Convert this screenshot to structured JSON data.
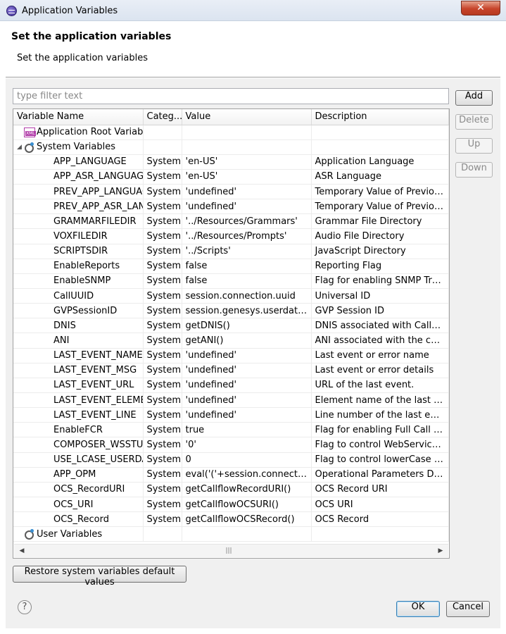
{
  "window": {
    "title": "Application Variables",
    "close_glyph": "✕"
  },
  "header": {
    "title": "Set the application variables",
    "subtitle": "Set the application variables"
  },
  "filter": {
    "placeholder": "type filter text",
    "value": ""
  },
  "table": {
    "columns": [
      "Variable Name",
      "Categ...",
      "Value",
      "Description"
    ],
    "groups": [
      {
        "name": "Application Root Variab",
        "icon": "xml-file-icon",
        "expanded": false
      },
      {
        "name": "System Variables",
        "icon": "variables-icon",
        "expanded": true
      },
      {
        "name": "User Variables",
        "icon": "variables-icon",
        "expanded": false
      }
    ],
    "rows": [
      [
        "APP_LANGUAGE",
        "System",
        "'en-US'",
        "Application Language"
      ],
      [
        "APP_ASR_LANGUAGE",
        "System",
        "'en-US'",
        "ASR Language"
      ],
      [
        "PREV_APP_LANGUAG",
        "System",
        "'undefined'",
        "Temporary Value of Previous ..."
      ],
      [
        "PREV_APP_ASR_LANG",
        "System",
        "'undefined'",
        "Temporary Value of Previous ..."
      ],
      [
        "GRAMMARFILEDIR",
        "System",
        "'../Resources/Grammars'",
        "Grammar File Directory"
      ],
      [
        "VOXFILEDIR",
        "System",
        "'../Resources/Prompts'",
        "Audio File Directory"
      ],
      [
        "SCRIPTSDIR",
        "System",
        "'../Scripts'",
        "JavaScript Directory"
      ],
      [
        "EnableReports",
        "System",
        "false",
        "Reporting Flag"
      ],
      [
        "EnableSNMP",
        "System",
        "false",
        "Flag for enabling SNMP Traps"
      ],
      [
        "CallUUID",
        "System",
        "session.connection.uuid",
        "Universal ID"
      ],
      [
        "GVPSessionID",
        "System",
        "session.genesys.userdata[\"G...",
        "GVP Session ID"
      ],
      [
        "DNIS",
        "System",
        "getDNIS()",
        "DNIS associated with Called p..."
      ],
      [
        "ANI",
        "System",
        "getANI()",
        "ANI associated with the callin..."
      ],
      [
        "LAST_EVENT_NAME",
        "System",
        "'undefined'",
        "Last event or error name"
      ],
      [
        "LAST_EVENT_MSG",
        "System",
        "'undefined'",
        "Last event or error details"
      ],
      [
        "LAST_EVENT_URL",
        "System",
        "'undefined'",
        "URL of the last event."
      ],
      [
        "LAST_EVENT_ELEMEN",
        "System",
        "'undefined'",
        "Element name of the last event"
      ],
      [
        "LAST_EVENT_LINE",
        "System",
        "'undefined'",
        "Line number of the last event"
      ],
      [
        "EnableFCR",
        "System",
        "true",
        "Flag for enabling Full Call Rec..."
      ],
      [
        "COMPOSER_WSSTUB",
        "System",
        "'0'",
        "Flag to control WebServices St..."
      ],
      [
        "USE_LCASE_USERDA",
        "System",
        "0",
        "Flag to control lowerCase look..."
      ],
      [
        "APP_OPM",
        "System",
        "eval('('+session.connection....",
        "Operational Parameters Data ..."
      ],
      [
        "OCS_RecordURI",
        "System",
        "getCallflowRecordURI()",
        "OCS Record URI"
      ],
      [
        "OCS_URI",
        "System",
        "getCallflowOCSURI()",
        "OCS URI"
      ],
      [
        "OCS_Record",
        "System",
        "getCallflowOCSRecord()",
        "OCS Record"
      ]
    ]
  },
  "buttons": {
    "add": "Add",
    "delete": "Delete",
    "up": "Up",
    "down": "Down",
    "restore": "Restore system variables default values",
    "ok": "OK",
    "cancel": "Cancel",
    "help": "?"
  },
  "glyphs": {
    "expanded": "◢",
    "collapsed": "▷",
    "scroll_left": "◀",
    "scroll_right": "▶",
    "scroll_thumb": "|||"
  },
  "colors": {
    "close_button": "#c7442a",
    "ok_border": "#3c7fb1"
  }
}
